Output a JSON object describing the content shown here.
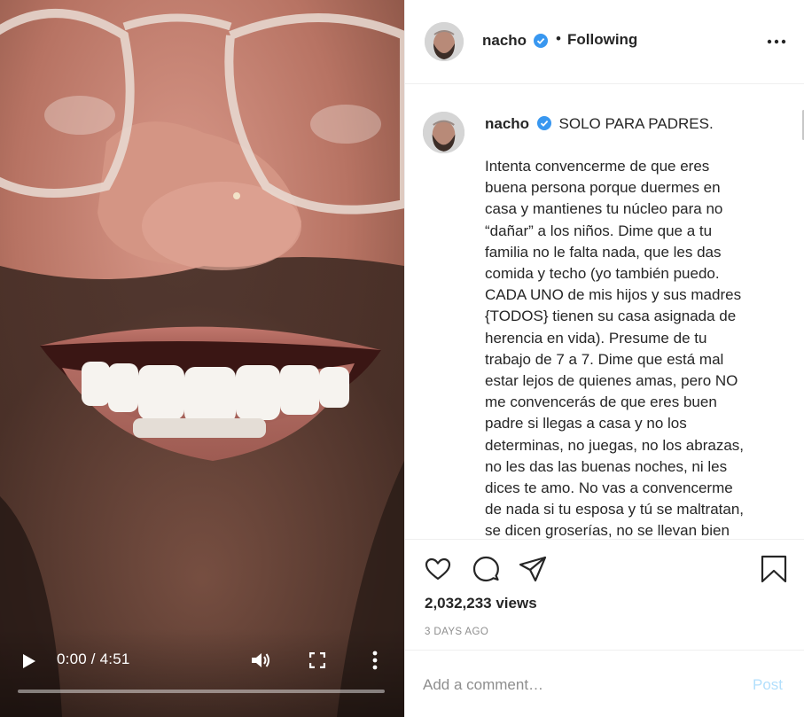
{
  "video": {
    "time": "0:00 / 4:51",
    "progress_fraction": 0.0,
    "icons": [
      "play-icon",
      "volume-icon",
      "fullscreen-icon",
      "more-vertical-icon"
    ]
  },
  "header": {
    "username": "nacho",
    "dot": "•",
    "follow_status": "Following",
    "icons": [
      "avatar",
      "verified-badge-icon",
      "more-horizontal-icon"
    ]
  },
  "caption": {
    "username": "nacho",
    "title": "SOLO PARA PADRES.",
    "body": "Intenta convencerme de que eres\nbuena persona porque duermes en\ncasa y mantienes tu núcleo para no\n“dañar” a los niños. Dime que a tu\nfamilia no le falta nada, que les das\ncomida y techo (yo también puedo.\nCADA UNO de mis hijos y sus madres\n{TODOS} tienen su casa asignada de\nherencia en vida). Presume de tu\ntrabajo de 7 a 7. Dime que está mal\nestar lejos de quienes amas, pero NO\nme convencerás de que eres buen\npadre si llegas a casa y no los\ndeterminas, no juegas, no los abrazas,\nno les das las buenas noches, ni les\ndices te amo. No vas a convencerme\nde nada si tu esposa y tú se maltratan,\nse dicen groserías, no se llevan bien"
  },
  "actions": {
    "views": "2,032,233 views",
    "date": "3 DAYS AGO",
    "icons": [
      "heart-icon",
      "comment-icon",
      "share-icon",
      "bookmark-icon"
    ]
  },
  "comment": {
    "placeholder": "Add a comment…",
    "post_label": "Post",
    "post_color": "#b2dffc"
  },
  "colors": {
    "verified": "#3897f0",
    "text": "#262626",
    "muted": "#8e8e8e",
    "divider": "#efefef"
  }
}
